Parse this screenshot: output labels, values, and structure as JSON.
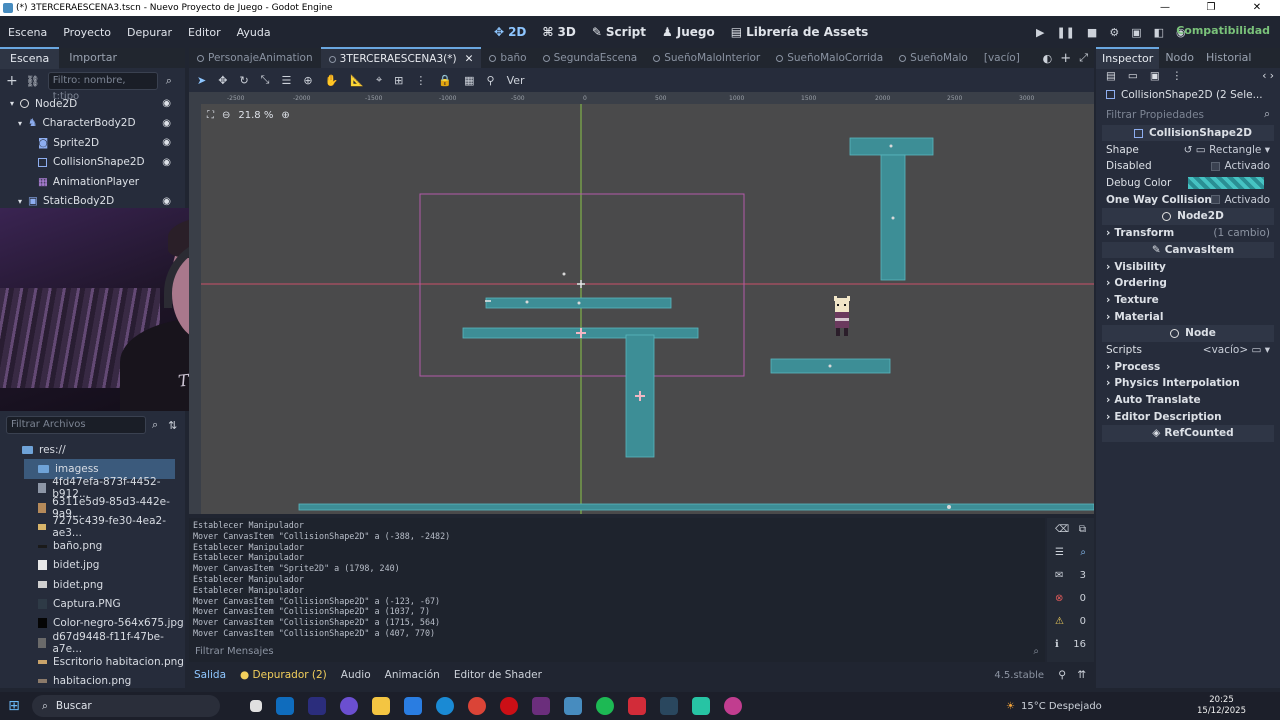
{
  "window": {
    "title": "(*) 3TERCERAESCENA3.tscn - Nuevo Proyecto de Juego - Godot Engine",
    "minimize": "—",
    "maximize": "❐",
    "close": "✕"
  },
  "menu": {
    "items": [
      "Escena",
      "Proyecto",
      "Depurar",
      "Editor",
      "Ayuda"
    ],
    "screens": [
      "2D",
      "3D",
      "Script",
      "Juego",
      "Librería de Assets"
    ],
    "active_screen": "2D",
    "renderer": "Compatibilidad"
  },
  "scene_dock": {
    "tabs": [
      "Escena",
      "Importar"
    ],
    "filter_placeholder": "Filtro: nombre, t:tipo",
    "nodes": [
      {
        "label": "Node2D",
        "icon": "node-icon"
      },
      {
        "label": "CharacterBody2D",
        "icon": "character-body-icon"
      },
      {
        "label": "Sprite2D",
        "icon": "sprite-icon"
      },
      {
        "label": "CollisionShape2D",
        "icon": "collision-shape-icon"
      },
      {
        "label": "AnimationPlayer",
        "icon": "animation-player-icon"
      },
      {
        "label": "StaticBody2D",
        "icon": "static-body-icon"
      }
    ]
  },
  "webcam": {
    "shirt_text": "Tmporta"
  },
  "filesystem": {
    "filter_placeholder": "Filtrar Archivos",
    "root": "res://",
    "selected_folder": "imagess",
    "files": [
      "4fd47efa-873f-4452-b912...",
      "6311e5d9-85d3-442e-9a9...",
      "7275c439-fe30-4ea2-ae3...",
      "baño.png",
      "bidet.jpg",
      "bidet.png",
      "Captura.PNG",
      "Color-negro-564x675.jpg",
      "d67d9448-f11f-47be-a7e...",
      "Escritorio habitacion.png",
      "habitacion.png"
    ]
  },
  "scene_tabs": {
    "tabs": [
      "PersonajeAnimation",
      "3TERCERAESCENA3(*)",
      "baño",
      "SegundaEscena",
      "SueñoMaloInterior",
      "SueñoMaloCorrida",
      "SueñoMalo",
      "[vacío]"
    ],
    "active": "3TERCERAESCENA3(*)"
  },
  "editor_toolbar": {
    "view_label": "Ver"
  },
  "viewport": {
    "zoom": "21.8 %",
    "ruler_labels": [
      "-2500",
      "-2000",
      "-1500",
      "-1000",
      "-500",
      "0",
      "500",
      "1000",
      "1500",
      "2000",
      "2500",
      "3000"
    ]
  },
  "output": {
    "lines": [
      "Establecer Manipulador",
      "Mover CanvasItem \"CollisionShape2D\" a (-388, -2482)",
      "Establecer Manipulador",
      "Establecer Manipulador",
      "Mover CanvasItem \"Sprite2D\" a (1798, 240)",
      "Establecer Manipulador",
      "Establecer Manipulador",
      "Mover CanvasItem \"CollisionShape2D\" a (-123, -67)",
      "Mover CanvasItem \"CollisionShape2D\" a (1037, 7)",
      "Mover CanvasItem \"CollisionShape2D\" a (1715, 564)",
      "Mover CanvasItem \"CollisionShape2D\" a (407, 770)"
    ],
    "filter_placeholder": "Filtrar Mensajes",
    "counts": {
      "messages": "3",
      "errors": "0",
      "warnings": "0",
      "info": "16"
    }
  },
  "bottom_tabs": {
    "tabs": [
      "Salida",
      "Depurador (2)",
      "Audio",
      "Animación",
      "Editor de Shader"
    ],
    "version": "4.5.stable"
  },
  "inspector": {
    "tabs": [
      "Inspector",
      "Nodo",
      "Historial"
    ],
    "selected_node": "CollisionShape2D (2 Sele...",
    "filter_placeholder": "Filtrar Propiedades",
    "class_header": "CollisionShape2D",
    "shape_label": "Shape",
    "shape_value": "Rectangle",
    "disabled_label": "Disabled",
    "disabled_value": "Activado",
    "debug_color_label": "Debug Color",
    "one_way_label": "One Way Collision",
    "one_way_value": "Activado",
    "node2d_header": "Node2D",
    "transform_label": "Transform",
    "transform_changes": "(1 cambio)",
    "canvasitem_header": "CanvasItem",
    "visibility_label": "Visibility",
    "ordering_label": "Ordering",
    "texture_label": "Texture",
    "material_label": "Material",
    "node_header": "Node",
    "scripts_label": "Scripts",
    "scripts_value": "<vacío>",
    "process_label": "Process",
    "physics_interp_label": "Physics Interpolation",
    "auto_translate_label": "Auto Translate",
    "editor_desc_label": "Editor Description",
    "refcounted_header": "RefCounted"
  },
  "taskbar": {
    "search_label": "Buscar",
    "weather": "15°C  Despejado",
    "time": "20:25",
    "date": "15/12/2025"
  },
  "colors": {
    "collision_fill": "#3d8e96",
    "accent": "#6aa7e0"
  }
}
